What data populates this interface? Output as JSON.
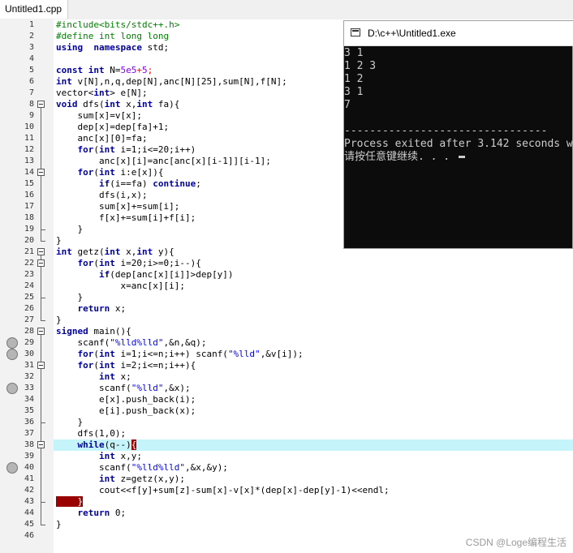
{
  "tab": {
    "label": "Untitled1.cpp"
  },
  "editor": {
    "current_line": 38,
    "breakpoints": [
      29,
      30,
      33,
      40
    ],
    "folds": [
      8,
      14,
      21,
      22,
      28,
      31,
      38
    ],
    "lines": [
      [
        [
          "pre",
          "#include<bits/stdc++.h>"
        ]
      ],
      [
        [
          "pre",
          "#define int long long"
        ]
      ],
      [
        [
          "kw",
          "using"
        ],
        [
          "",
          "  "
        ],
        [
          "kw",
          "namespace"
        ],
        [
          "",
          " std;"
        ]
      ],
      [
        [
          "",
          ""
        ]
      ],
      [
        [
          "kw",
          "const"
        ],
        [
          "",
          ""
        ],
        [
          "kw",
          " int"
        ],
        [
          "",
          " N="
        ],
        [
          "num",
          "5e5"
        ],
        [
          "sym",
          "+"
        ],
        [
          "num",
          "5"
        ],
        [
          "sym",
          ";"
        ]
      ],
      [
        [
          "kw",
          "int"
        ],
        [
          "",
          " v[N],n,q,dep[N],anc[N][25],sum[N],f[N];"
        ]
      ],
      [
        [
          "",
          "vector<"
        ],
        [
          "kw",
          "int"
        ],
        [
          "",
          "> e[N];"
        ]
      ],
      [
        [
          "kw",
          "void"
        ],
        [
          "",
          " dfs("
        ],
        [
          "kw",
          "int"
        ],
        [
          "",
          " x,"
        ],
        [
          "kw",
          "int"
        ],
        [
          "",
          " fa){"
        ]
      ],
      [
        [
          "",
          "    sum[x]=v[x];"
        ]
      ],
      [
        [
          "",
          "    dep[x]=dep[fa]+1;"
        ]
      ],
      [
        [
          "",
          "    anc[x][0]=fa;"
        ]
      ],
      [
        [
          "kw",
          "    for"
        ],
        [
          "",
          "("
        ],
        [
          "kw",
          "int"
        ],
        [
          "",
          " i=1;i<=20;i++)"
        ]
      ],
      [
        [
          "",
          "        anc[x][i]=anc[anc[x][i-1]][i-1];"
        ]
      ],
      [
        [
          "kw",
          "    for"
        ],
        [
          "",
          "("
        ],
        [
          "kw",
          "int"
        ],
        [
          "",
          " i:e[x]){"
        ]
      ],
      [
        [
          "kw",
          "        if"
        ],
        [
          "",
          "(i==fa) "
        ],
        [
          "kw",
          "continue"
        ],
        [
          "",
          ";"
        ]
      ],
      [
        [
          "",
          "        dfs(i,x);"
        ]
      ],
      [
        [
          "",
          "        sum[x]+=sum[i];"
        ]
      ],
      [
        [
          "",
          "        f[x]+=sum[i]+f[i];"
        ]
      ],
      [
        [
          "",
          "    }"
        ]
      ],
      [
        [
          "",
          "}"
        ]
      ],
      [
        [
          "kw",
          "int"
        ],
        [
          "",
          " getz("
        ],
        [
          "kw",
          "int"
        ],
        [
          "",
          " x,"
        ],
        [
          "kw",
          "int"
        ],
        [
          "",
          " y){"
        ]
      ],
      [
        [
          "kw",
          "    for"
        ],
        [
          "",
          "("
        ],
        [
          "kw",
          "int"
        ],
        [
          "",
          " i=20;i>=0;i--){"
        ]
      ],
      [
        [
          "kw",
          "        if"
        ],
        [
          "",
          "(dep[anc[x][i]]>dep[y])"
        ]
      ],
      [
        [
          "",
          "            x=anc[x][i];"
        ]
      ],
      [
        [
          "",
          "    }"
        ]
      ],
      [
        [
          "kw",
          "    return"
        ],
        [
          "",
          " x;"
        ]
      ],
      [
        [
          "",
          "}"
        ]
      ],
      [
        [
          "kw",
          "signed"
        ],
        [
          "",
          " main(){"
        ]
      ],
      [
        [
          "",
          "    scanf("
        ],
        [
          "str",
          "\"%lld%lld\""
        ],
        [
          "",
          ",&n,&q);"
        ]
      ],
      [
        [
          "kw",
          "    for"
        ],
        [
          "",
          "("
        ],
        [
          "kw",
          "int"
        ],
        [
          "",
          " i=1;i<=n;i++) scanf("
        ],
        [
          "str",
          "\"%lld\""
        ],
        [
          "",
          ",&v[i]);"
        ]
      ],
      [
        [
          "kw",
          "    for"
        ],
        [
          "",
          "("
        ],
        [
          "kw",
          "int"
        ],
        [
          "",
          " i=2;i<=n;i++){"
        ]
      ],
      [
        [
          "kw",
          "        int"
        ],
        [
          "",
          " x;"
        ]
      ],
      [
        [
          "",
          "        scanf("
        ],
        [
          "str",
          "\"%lld\""
        ],
        [
          "",
          ",&x);"
        ]
      ],
      [
        [
          "",
          "        e[x].push_back(i);"
        ]
      ],
      [
        [
          "",
          "        e[i].push_back(x);"
        ]
      ],
      [
        [
          "",
          "    }"
        ]
      ],
      [
        [
          "",
          "    dfs(1,0);"
        ]
      ],
      [
        [
          "kw",
          "    while"
        ],
        [
          "",
          "(q--)"
        ],
        [
          "mark",
          "{"
        ]
      ],
      [
        [
          "kw",
          "        int"
        ],
        [
          "",
          " x,y;"
        ]
      ],
      [
        [
          "",
          "        scanf("
        ],
        [
          "str",
          "\"%lld%lld\""
        ],
        [
          "",
          ",&x,&y);"
        ]
      ],
      [
        [
          "kw",
          "        int"
        ],
        [
          "",
          " z=getz(x,y);"
        ]
      ],
      [
        [
          "",
          "        cout<<f[y]+sum[z]-sum[x]-v[x]*(dep[x]-dep[y]-1)<<endl;"
        ]
      ],
      [
        [
          "mark",
          "    }"
        ]
      ],
      [
        [
          "kw",
          "    return"
        ],
        [
          "",
          " 0;"
        ]
      ],
      [
        [
          "",
          "}"
        ]
      ],
      [
        [
          "",
          ""
        ]
      ]
    ]
  },
  "console": {
    "title": "D:\\c++\\Untitled1.exe",
    "lines": [
      "3 1",
      "1 2 3",
      "1 2",
      "3 1",
      "7",
      "",
      "--------------------------------",
      "Process exited after 3.142 seconds w",
      "请按任意键继续. . . "
    ]
  },
  "watermark": "CSDN @Loge编程生活"
}
